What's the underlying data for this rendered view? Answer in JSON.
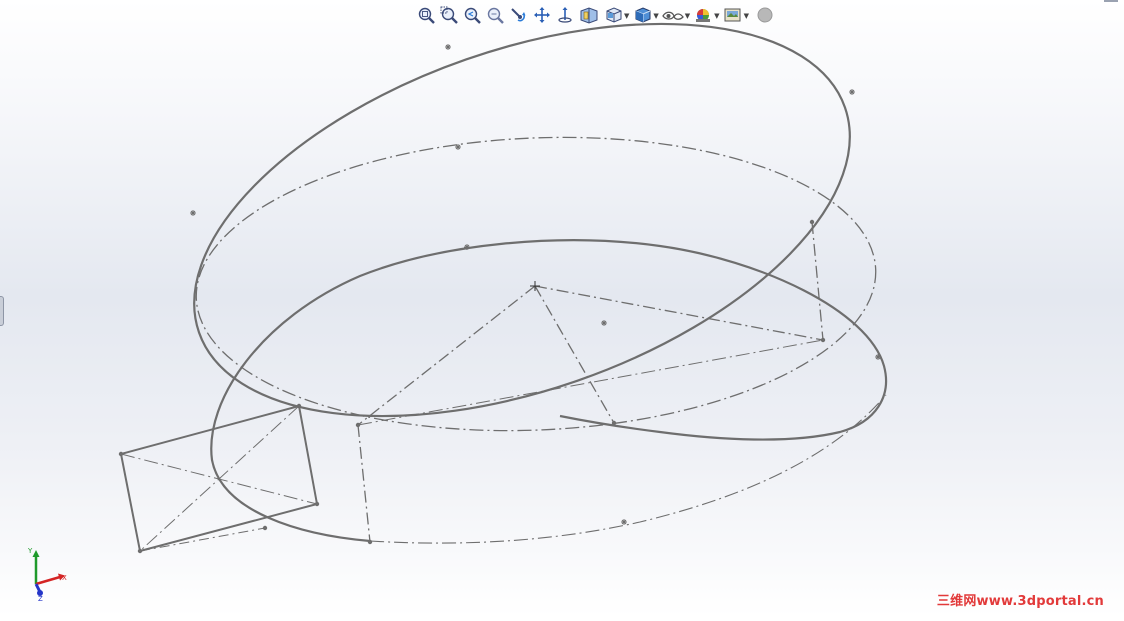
{
  "toolbar": {
    "tools": [
      {
        "name": "zoom-to-fit-icon",
        "has_caret": false
      },
      {
        "name": "zoom-to-area-icon",
        "has_caret": false
      },
      {
        "name": "previous-view-icon",
        "has_caret": false
      },
      {
        "name": "zoom-in-out-icon",
        "has_caret": false
      },
      {
        "name": "rotate-view-icon",
        "has_caret": false
      },
      {
        "name": "pan-icon",
        "has_caret": false
      },
      {
        "name": "roll-view-icon",
        "has_caret": false
      },
      {
        "name": "section-view-icon",
        "has_caret": false
      },
      {
        "name": "view-orientation-icon",
        "has_caret": true
      },
      {
        "name": "display-style-icon",
        "has_caret": true
      },
      {
        "name": "hide-show-items-icon",
        "has_caret": true
      },
      {
        "name": "edit-appearance-icon",
        "has_caret": true
      },
      {
        "name": "apply-scene-icon",
        "has_caret": true
      },
      {
        "name": "view-settings-icon",
        "has_caret": false
      }
    ]
  },
  "triad": {
    "x_label": "X",
    "y_label": "Y",
    "z_label": "Z",
    "x_color": "#d42424",
    "y_color": "#1f9a2b",
    "z_color": "#2435c8"
  },
  "watermark": {
    "text": "三维网www.3dportal.cn",
    "color": "#e23a3a"
  },
  "colors": {
    "sketch_line": "#6e6e6e",
    "background_top": "#ffffff",
    "background_mid": "#e4e8f0"
  }
}
